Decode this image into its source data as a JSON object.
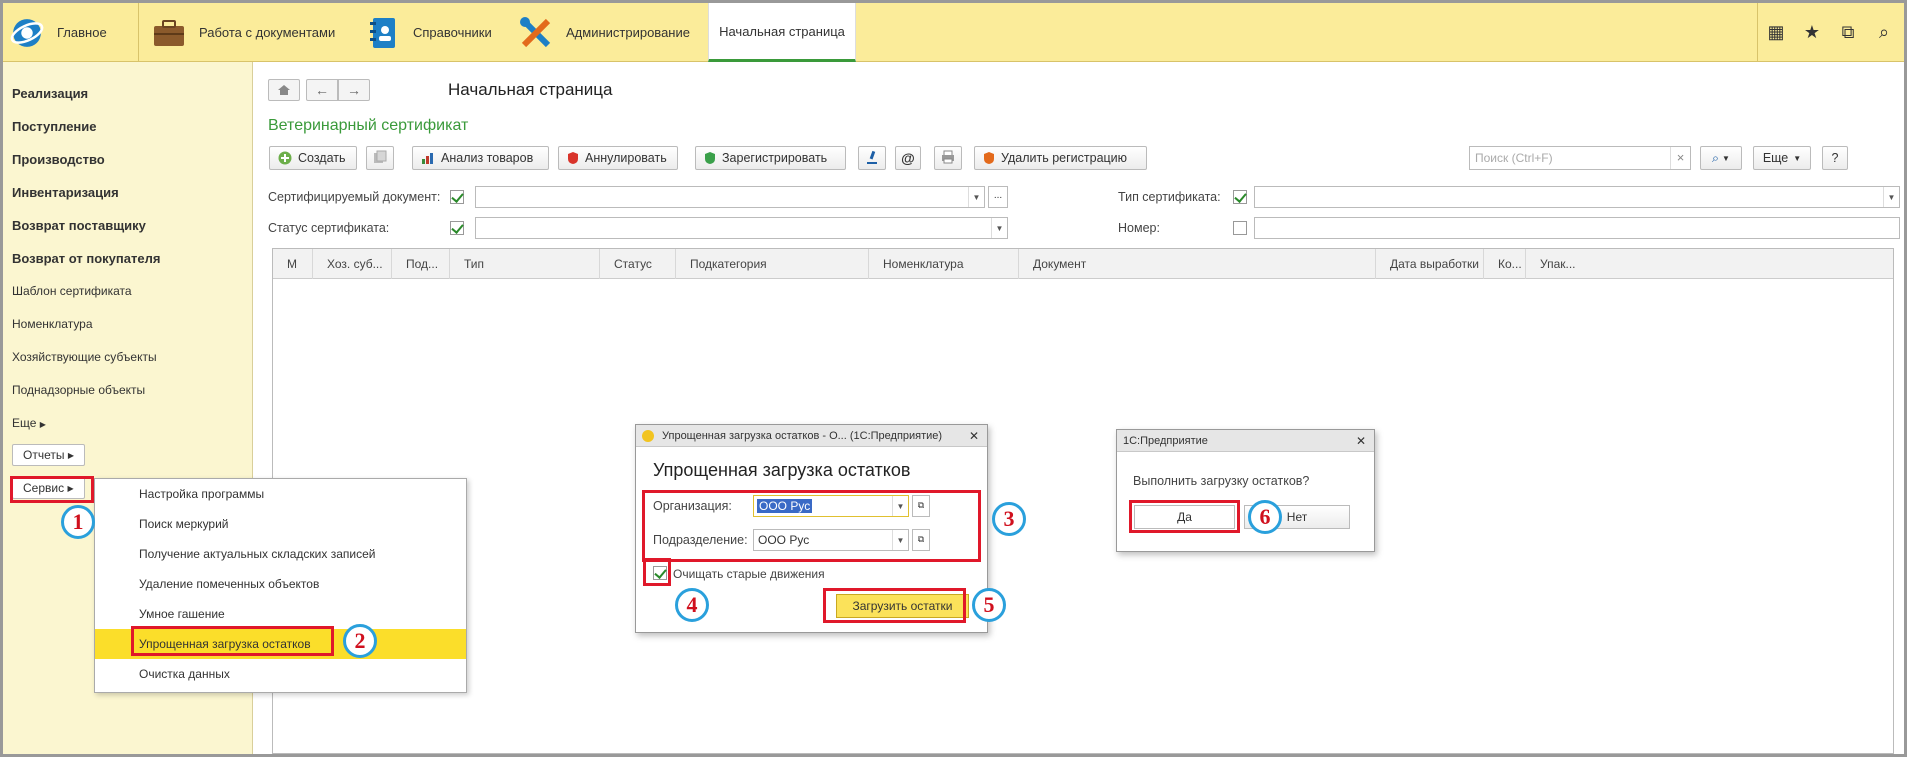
{
  "topbar": {
    "sections": [
      {
        "label": "Главное",
        "icon": "app-logo-icon"
      },
      {
        "label": "Работа с документами",
        "icon": "briefcase-icon"
      },
      {
        "label": "Справочники",
        "icon": "address-book-icon"
      },
      {
        "label": "Администрирование",
        "icon": "tools-icon"
      }
    ],
    "active_tab": "Начальная страница",
    "right_icons": [
      "apps-grid-icon",
      "star-icon",
      "history-icon",
      "search-icon"
    ],
    "right_glyphs": [
      "▦",
      "★",
      "⧉",
      "⌕"
    ]
  },
  "sidebar": {
    "bold_items": [
      "Реализация",
      "Поступление",
      "Производство",
      "Инвентаризация",
      "Возврат поставщику",
      "Возврат от покупателя"
    ],
    "items": [
      "Шаблон сертификата",
      "Номенклатура",
      "Хозяйствующие субъекты",
      "Поднадзорные объекты"
    ],
    "more": "Еще",
    "reports_btn": "Отчеты",
    "service_btn": "Сервис"
  },
  "main": {
    "page_title": "Начальная страница",
    "form_title": "Ветеринарный сертификат",
    "toolbar": {
      "create": "Создать",
      "analysis": "Анализ товаров",
      "annul": "Аннулировать",
      "register": "Зарегистрировать",
      "at": "@",
      "delete_reg": "Удалить регистрацию",
      "search_placeholder": "Поиск (Ctrl+F)",
      "clear": "×",
      "more": "Еще",
      "help": "?"
    },
    "filters": {
      "cert_doc_label": "Сертифицируемый документ:",
      "cert_status_label": "Статус сертификата:",
      "cert_type_label": "Тип сертификата:",
      "number_label": "Номер:",
      "ellipsis": "..."
    },
    "columns": [
      "М",
      "Хоз. суб...",
      "Под...",
      "Тип",
      "Статус",
      "Подкатегория",
      "Номенклатура",
      "Документ",
      "Дата выработки",
      "Ко...",
      "Упак..."
    ]
  },
  "service_menu": {
    "items": [
      "Настройка программы",
      "Поиск меркурий",
      "Получение актуальных складских записей",
      "Удаление помеченных объектов",
      "Умное гашение",
      "Упрощенная загрузка остатков",
      "Очистка данных"
    ],
    "selected_index": 5
  },
  "load_dialog": {
    "window_title": "Упрощенная загрузка остатков - О... (1С:Предприятие)",
    "heading": "Упрощенная загрузка остатков",
    "org_label": "Организация:",
    "org_value": "ООО Рус",
    "dept_label": "Подразделение:",
    "dept_value": "ООО Рус",
    "clear_label": "Очищать старые движения",
    "submit": "Загрузить остатки",
    "close": "✕"
  },
  "confirm_dialog": {
    "window_title": "1С:Предприятие",
    "question": "Выполнить загрузку остатков?",
    "yes": "Да",
    "no": "Нет",
    "close": "✕"
  },
  "annotations": [
    "1",
    "2",
    "3",
    "4",
    "5",
    "6"
  ],
  "colors": {
    "topbar": "#fbec9a",
    "sidebar": "#fbf6d0",
    "highlight": "#fbde2a",
    "marker_red": "#e0182a",
    "marker_blue": "#2aa0dc",
    "title_green": "#3a9a3a"
  }
}
